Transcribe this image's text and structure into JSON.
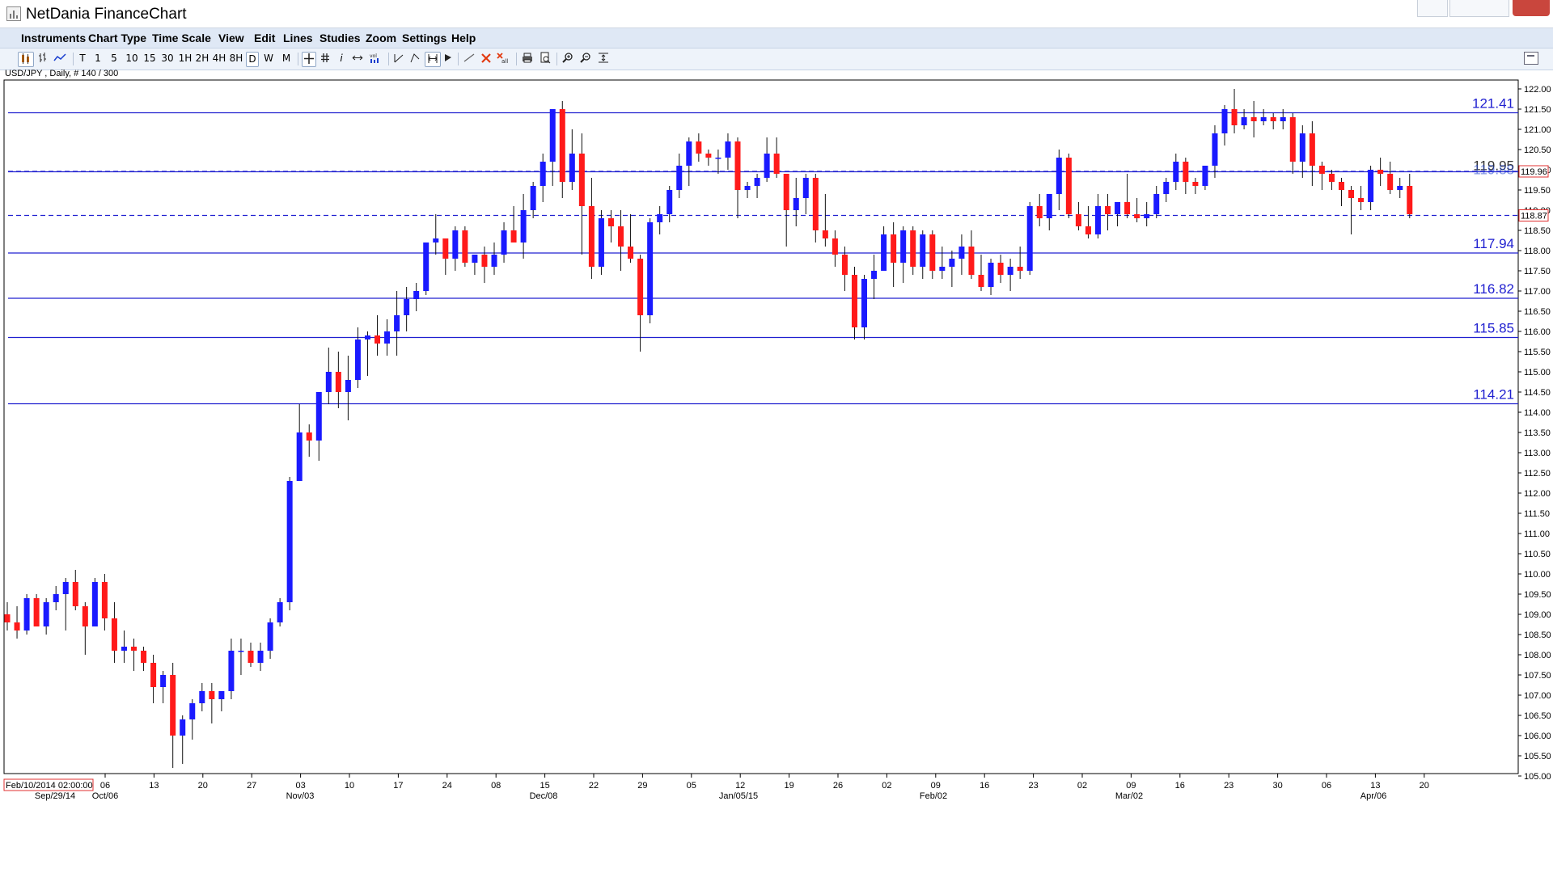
{
  "window": {
    "title": "NetDania FinanceChart"
  },
  "menu": [
    "Instruments",
    "Chart Type",
    "Time Scale",
    "View",
    "Edit",
    "Lines",
    "Studies",
    "Zoom",
    "Settings",
    "Help"
  ],
  "toolbar": {
    "timeframes": [
      "T",
      "1",
      "5",
      "10",
      "15",
      "30",
      "1H",
      "2H",
      "4H",
      "8H",
      "D",
      "W",
      "M"
    ],
    "selected_timeframe": "D",
    "icons": [
      "candlestick-icon",
      "bar-chart-icon",
      "line-chart-icon",
      "crosshair-icon",
      "grid-icon",
      "info-icon",
      "arrows-icon",
      "volume-icon",
      "trend-line-icon",
      "fib-icon",
      "cursor-icon",
      "draw-line-icon",
      "delete-icon",
      "delete-all-icon",
      "print-icon",
      "print-preview-icon",
      "zoom-in-icon",
      "zoom-out-icon",
      "zoom-fit-icon"
    ]
  },
  "instrument_label": "USD/JPY , Daily, # 140 / 300",
  "colors": {
    "up": "#1a1aff",
    "down": "#ff1a1a",
    "level_line": "#2020d0",
    "grid_axis": "#000000"
  },
  "chart_data": {
    "type": "candlestick",
    "instrument": "USD/JPY",
    "timeframe": "Daily",
    "y_range": [
      105.0,
      122.0
    ],
    "y_ticks": [
      "122.00",
      "121.50",
      "121.00",
      "120.50",
      "120.00",
      "119.50",
      "119.00",
      "118.50",
      "118.00",
      "117.50",
      "117.00",
      "116.50",
      "116.00",
      "115.50",
      "115.00",
      "114.50",
      "114.00",
      "113.50",
      "113.00",
      "112.50",
      "112.00",
      "111.50",
      "111.00",
      "110.50",
      "110.00",
      "109.50",
      "109.00",
      "108.50",
      "108.00",
      "107.50",
      "107.00",
      "106.50",
      "106.00",
      "105.50",
      "105.00"
    ],
    "x_ticks": [
      "06",
      "13",
      "20",
      "27",
      "03",
      "10",
      "17",
      "24",
      "08",
      "15",
      "22",
      "29",
      "05",
      "12",
      "19",
      "26",
      "02",
      "09",
      "16",
      "23",
      "02",
      "09",
      "16",
      "23",
      "30",
      "06",
      "13",
      "20"
    ],
    "x_period_labels": [
      "Sep/29/14",
      "Oct/06",
      "Nov/03",
      "Dec/08",
      "Jan/05/15",
      "Feb/02",
      "Mar/02",
      "Apr/06"
    ],
    "cursor_date": "Feb/10/2014 02:00:00",
    "levels": [
      {
        "value": 121.41,
        "label": "121.41",
        "style": "solid"
      },
      {
        "value": 119.95,
        "label": "119.95",
        "style": "solid"
      },
      {
        "value": 117.94,
        "label": "117.94",
        "style": "solid"
      },
      {
        "value": 116.82,
        "label": "116.82",
        "style": "solid"
      },
      {
        "value": 115.85,
        "label": "115.85",
        "style": "solid"
      },
      {
        "value": 114.21,
        "label": "114.21",
        "style": "solid"
      },
      {
        "value": 118.87,
        "label": "118.87",
        "style": "dashed"
      },
      {
        "value": 119.96,
        "label": "119.96",
        "style": "dashed"
      }
    ],
    "price_tags": [
      "119.96",
      "118.87"
    ],
    "overlapping_level_labels": [
      "119.95",
      "119.88"
    ],
    "candles": [
      [
        109.0,
        109.3,
        108.6,
        108.8
      ],
      [
        108.8,
        109.2,
        108.4,
        108.6
      ],
      [
        108.6,
        109.5,
        108.5,
        109.4
      ],
      [
        109.4,
        109.5,
        108.7,
        108.7
      ],
      [
        108.7,
        109.4,
        108.5,
        109.3
      ],
      [
        109.3,
        109.7,
        109.1,
        109.5
      ],
      [
        109.5,
        109.9,
        108.6,
        109.8
      ],
      [
        109.8,
        110.1,
        109.1,
        109.2
      ],
      [
        109.2,
        109.3,
        108.0,
        108.7
      ],
      [
        108.7,
        109.9,
        108.7,
        109.8
      ],
      [
        109.8,
        110.0,
        108.6,
        108.9
      ],
      [
        108.9,
        109.3,
        107.8,
        108.1
      ],
      [
        108.1,
        108.6,
        107.8,
        108.2
      ],
      [
        108.2,
        108.4,
        107.6,
        108.1
      ],
      [
        108.1,
        108.2,
        107.6,
        107.8
      ],
      [
        107.8,
        108.0,
        106.8,
        107.2
      ],
      [
        107.2,
        107.6,
        106.8,
        107.5
      ],
      [
        107.5,
        107.8,
        105.2,
        106.0
      ],
      [
        106.0,
        106.5,
        105.3,
        106.4
      ],
      [
        106.4,
        106.9,
        105.9,
        106.8
      ],
      [
        106.8,
        107.3,
        106.6,
        107.1
      ],
      [
        107.1,
        107.3,
        106.3,
        106.9
      ],
      [
        106.9,
        107.1,
        106.6,
        107.1
      ],
      [
        107.1,
        108.4,
        106.9,
        108.1
      ],
      [
        108.1,
        108.4,
        107.5,
        108.1
      ],
      [
        108.1,
        108.3,
        107.7,
        107.8
      ],
      [
        107.8,
        108.3,
        107.6,
        108.1
      ],
      [
        108.1,
        108.9,
        107.9,
        108.8
      ],
      [
        108.8,
        109.4,
        108.7,
        109.3
      ],
      [
        109.3,
        112.4,
        109.1,
        112.3
      ],
      [
        112.3,
        114.2,
        112.4,
        113.5
      ],
      [
        113.5,
        113.7,
        112.9,
        113.3
      ],
      [
        113.3,
        114.5,
        112.8,
        114.5
      ],
      [
        114.5,
        115.6,
        114.2,
        115.0
      ],
      [
        115.0,
        115.5,
        114.1,
        114.5
      ],
      [
        114.5,
        115.4,
        113.8,
        114.8
      ],
      [
        114.8,
        116.1,
        114.6,
        115.8
      ],
      [
        115.8,
        116.0,
        114.9,
        115.9
      ],
      [
        115.9,
        116.4,
        115.4,
        115.7
      ],
      [
        115.7,
        116.3,
        115.4,
        116.0
      ],
      [
        116.0,
        117.0,
        115.4,
        116.4
      ],
      [
        116.4,
        117.1,
        116.0,
        116.8
      ],
      [
        116.8,
        117.2,
        116.5,
        117.0
      ],
      [
        117.0,
        118.2,
        116.9,
        118.2
      ],
      [
        118.2,
        118.9,
        117.9,
        118.3
      ],
      [
        118.3,
        118.3,
        117.4,
        117.8
      ],
      [
        117.8,
        118.6,
        117.5,
        118.5
      ],
      [
        118.5,
        118.6,
        117.6,
        117.7
      ],
      [
        117.7,
        117.9,
        117.4,
        117.9
      ],
      [
        117.9,
        118.1,
        117.2,
        117.6
      ],
      [
        117.6,
        118.2,
        117.4,
        117.9
      ],
      [
        117.9,
        118.7,
        117.7,
        118.5
      ],
      [
        118.5,
        119.1,
        118.2,
        118.2
      ],
      [
        118.2,
        119.4,
        117.8,
        119.0
      ],
      [
        119.0,
        119.7,
        118.8,
        119.6
      ],
      [
        119.6,
        120.4,
        119.2,
        120.2
      ],
      [
        120.2,
        121.3,
        119.6,
        121.5
      ],
      [
        121.5,
        121.7,
        119.3,
        119.7
      ],
      [
        119.7,
        121.0,
        119.5,
        120.4
      ],
      [
        120.4,
        120.9,
        117.9,
        119.1
      ],
      [
        119.1,
        119.8,
        117.3,
        117.6
      ],
      [
        117.6,
        119.0,
        117.4,
        118.8
      ],
      [
        118.8,
        119.0,
        118.2,
        118.6
      ],
      [
        118.6,
        119.0,
        117.5,
        118.1
      ],
      [
        118.1,
        118.9,
        117.7,
        117.8
      ],
      [
        117.8,
        117.9,
        115.5,
        116.4
      ],
      [
        116.4,
        118.8,
        116.2,
        118.7
      ],
      [
        118.7,
        119.1,
        118.4,
        118.9
      ],
      [
        118.9,
        119.6,
        118.7,
        119.5
      ],
      [
        119.5,
        120.4,
        119.3,
        120.1
      ],
      [
        120.1,
        120.8,
        119.6,
        120.7
      ],
      [
        120.7,
        120.9,
        120.2,
        120.4
      ],
      [
        120.4,
        120.5,
        120.1,
        120.3
      ],
      [
        120.3,
        120.5,
        119.9,
        120.3
      ],
      [
        120.3,
        120.9,
        120.0,
        120.7
      ],
      [
        120.7,
        120.8,
        118.8,
        119.5
      ],
      [
        119.5,
        119.7,
        119.3,
        119.6
      ],
      [
        119.6,
        119.9,
        119.3,
        119.8
      ],
      [
        119.8,
        120.8,
        119.7,
        120.4
      ],
      [
        120.4,
        120.8,
        119.8,
        119.9
      ],
      [
        119.9,
        119.9,
        118.1,
        119.0
      ],
      [
        119.0,
        119.8,
        118.6,
        119.3
      ],
      [
        119.3,
        119.9,
        118.9,
        119.8
      ],
      [
        119.8,
        119.9,
        118.2,
        118.5
      ],
      [
        118.5,
        119.4,
        118.1,
        118.3
      ],
      [
        118.3,
        118.5,
        117.6,
        117.9
      ],
      [
        117.9,
        118.1,
        117.0,
        117.4
      ],
      [
        117.4,
        117.6,
        115.8,
        116.1
      ],
      [
        116.1,
        117.4,
        115.8,
        117.3
      ],
      [
        117.3,
        117.9,
        116.8,
        117.5
      ],
      [
        117.5,
        118.6,
        117.5,
        118.4
      ],
      [
        118.4,
        118.7,
        117.1,
        117.7
      ],
      [
        117.7,
        118.6,
        117.2,
        118.5
      ],
      [
        118.5,
        118.6,
        117.4,
        117.6
      ],
      [
        117.6,
        118.5,
        117.3,
        118.4
      ],
      [
        118.4,
        118.5,
        117.3,
        117.5
      ],
      [
        117.5,
        118.1,
        117.3,
        117.6
      ],
      [
        117.6,
        118.0,
        117.1,
        117.8
      ],
      [
        117.8,
        118.4,
        117.4,
        118.1
      ],
      [
        118.1,
        118.5,
        117.3,
        117.4
      ],
      [
        117.4,
        117.9,
        117.0,
        117.1
      ],
      [
        117.1,
        117.8,
        116.9,
        117.7
      ],
      [
        117.7,
        117.9,
        117.2,
        117.4
      ],
      [
        117.4,
        117.8,
        117.0,
        117.6
      ],
      [
        117.6,
        118.1,
        117.3,
        117.5
      ],
      [
        117.5,
        119.2,
        117.4,
        119.1
      ],
      [
        119.1,
        119.4,
        118.6,
        118.8
      ],
      [
        118.8,
        119.4,
        118.5,
        119.4
      ],
      [
        119.4,
        120.5,
        119.0,
        120.3
      ],
      [
        120.3,
        120.4,
        118.8,
        118.9
      ],
      [
        118.9,
        119.2,
        118.5,
        118.6
      ],
      [
        118.6,
        119.1,
        118.3,
        118.4
      ],
      [
        118.4,
        119.4,
        118.3,
        119.1
      ],
      [
        119.1,
        119.4,
        118.5,
        118.9
      ],
      [
        118.9,
        119.2,
        118.6,
        119.2
      ],
      [
        119.2,
        119.9,
        118.8,
        118.9
      ],
      [
        118.9,
        119.3,
        118.7,
        118.8
      ],
      [
        118.8,
        119.2,
        118.6,
        118.9
      ],
      [
        118.9,
        119.6,
        118.8,
        119.4
      ],
      [
        119.4,
        119.8,
        119.2,
        119.7
      ],
      [
        119.7,
        120.4,
        119.5,
        120.2
      ],
      [
        120.2,
        120.3,
        119.4,
        119.7
      ],
      [
        119.7,
        119.8,
        119.4,
        119.6
      ],
      [
        119.6,
        120.1,
        119.5,
        120.1
      ],
      [
        120.1,
        121.1,
        119.8,
        120.9
      ],
      [
        120.9,
        121.6,
        120.6,
        121.5
      ],
      [
        121.5,
        122.0,
        120.9,
        121.1
      ],
      [
        121.1,
        121.5,
        121.0,
        121.3
      ],
      [
        121.3,
        121.7,
        120.8,
        121.2
      ],
      [
        121.2,
        121.5,
        121.1,
        121.3
      ],
      [
        121.3,
        121.4,
        121.0,
        121.2
      ],
      [
        121.2,
        121.5,
        121.0,
        121.3
      ],
      [
        121.3,
        121.4,
        119.9,
        120.2
      ],
      [
        120.2,
        121.1,
        119.8,
        120.9
      ],
      [
        120.9,
        121.2,
        119.6,
        120.1
      ],
      [
        120.1,
        120.2,
        119.5,
        119.9
      ],
      [
        119.9,
        120.0,
        119.5,
        119.7
      ],
      [
        119.7,
        119.8,
        119.1,
        119.5
      ],
      [
        119.5,
        119.6,
        118.4,
        119.3
      ],
      [
        119.3,
        119.6,
        119.0,
        119.2
      ],
      [
        119.2,
        120.1,
        119.0,
        120.0
      ],
      [
        120.0,
        120.3,
        119.6,
        119.9
      ],
      [
        119.9,
        120.2,
        119.4,
        119.5
      ],
      [
        119.5,
        119.8,
        119.3,
        119.6
      ],
      [
        119.6,
        119.9,
        118.8,
        118.9
      ]
    ]
  }
}
